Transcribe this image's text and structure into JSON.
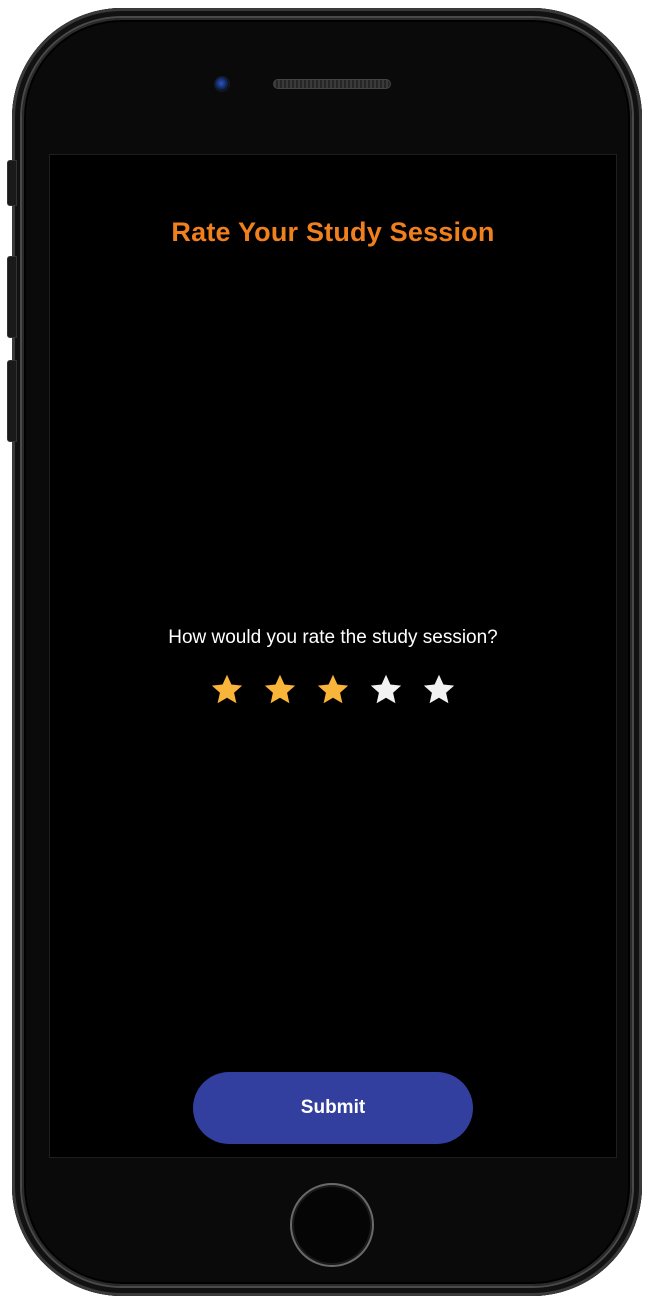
{
  "screen": {
    "title": "Rate Your Study Session",
    "prompt": "How would you rate the study session?",
    "submit_label": "Submit"
  },
  "rating": {
    "value": 3,
    "max": 5,
    "icon": "star-icon"
  },
  "colors": {
    "title": "#F07F1E",
    "star_filled": "#F9B43A",
    "star_empty": "#F2F2F2",
    "submit_bg": "#323F9F",
    "screen_bg": "#000000"
  }
}
